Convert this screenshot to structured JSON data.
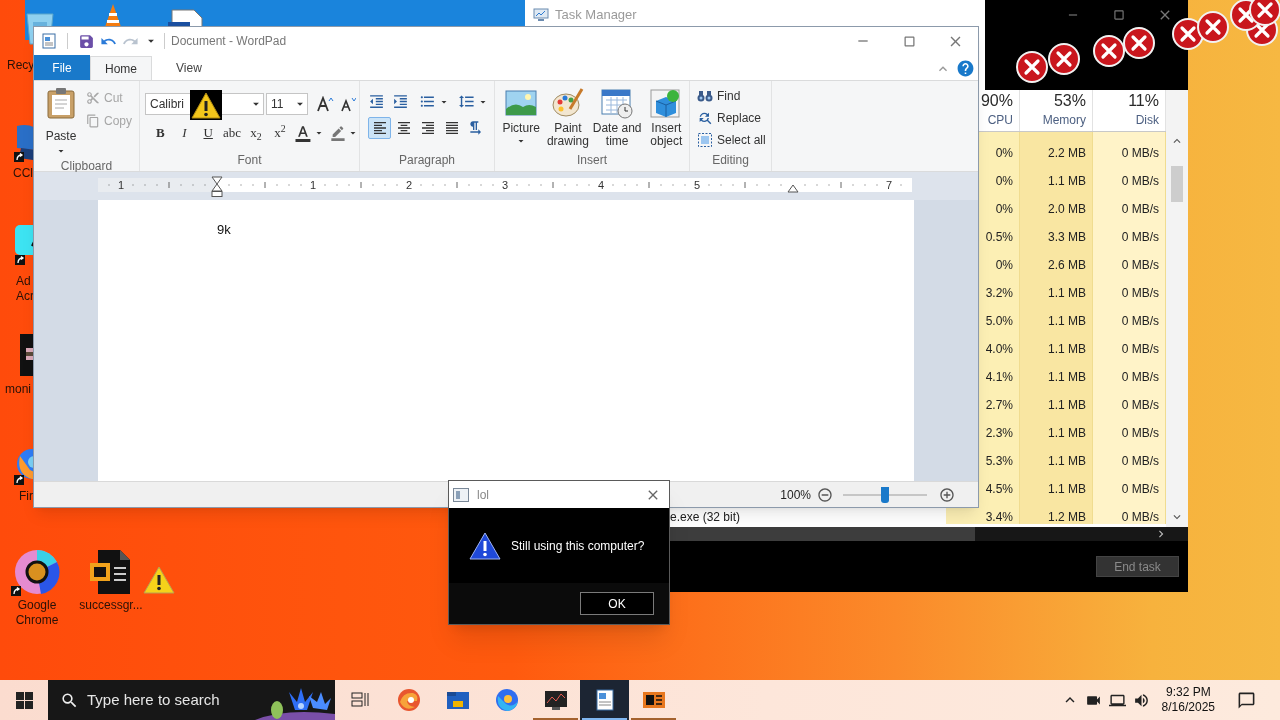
{
  "desktop_icons": [
    {
      "kind": "recycle-bin",
      "label": "Recy"
    },
    {
      "kind": "cone"
    },
    {
      "kind": "document"
    },
    {
      "kind": "ccleaner",
      "label": "CCl"
    },
    {
      "kind": "acrobat",
      "label": "Ad\nAcr"
    },
    {
      "kind": "monitor",
      "label": "moni"
    },
    {
      "kind": "firefox",
      "label": "Fir"
    },
    {
      "kind": "chrome",
      "label": "Google\nChrome"
    },
    {
      "kind": "word",
      "label": "successgr..."
    },
    {
      "kind": "warning"
    }
  ],
  "task_manager": {
    "title": "Task Manager",
    "columns": [
      {
        "value": "90%",
        "label": "CPU"
      },
      {
        "value": "53%",
        "label": "Memory"
      },
      {
        "value": "11%",
        "label": "Disk"
      }
    ],
    "rows": [
      {
        "cpu": "0%",
        "memory": "2.2 MB",
        "disk": "0 MB/s"
      },
      {
        "cpu": "0%",
        "memory": "1.1 MB",
        "disk": "0 MB/s"
      },
      {
        "cpu": "0%",
        "memory": "2.0 MB",
        "disk": "0 MB/s"
      },
      {
        "cpu": "0.5%",
        "memory": "3.3 MB",
        "disk": "0 MB/s"
      },
      {
        "cpu": "0%",
        "memory": "2.6 MB",
        "disk": "0 MB/s"
      },
      {
        "cpu": "3.2%",
        "memory": "1.1 MB",
        "disk": "0 MB/s"
      },
      {
        "cpu": "5.0%",
        "memory": "1.1 MB",
        "disk": "0 MB/s"
      },
      {
        "cpu": "4.0%",
        "memory": "1.1 MB",
        "disk": "0 MB/s"
      },
      {
        "cpu": "4.1%",
        "memory": "1.1 MB",
        "disk": "0 MB/s"
      },
      {
        "cpu": "2.7%",
        "memory": "1.1 MB",
        "disk": "0 MB/s"
      },
      {
        "cpu": "2.3%",
        "memory": "1.1 MB",
        "disk": "0 MB/s"
      },
      {
        "cpu": "5.3%",
        "memory": "1.1 MB",
        "disk": "0 MB/s"
      },
      {
        "cpu": "4.5%",
        "memory": "1.1 MB",
        "disk": "0 MB/s"
      },
      {
        "name": "e.exe (32 bit)",
        "cpu": "3.4%",
        "memory": "1.2 MB",
        "disk": "0 MB/s"
      }
    ],
    "button": {
      "label": "End task",
      "disabled": true
    }
  },
  "wordpad": {
    "title": "Document - WordPad",
    "quick_access": [
      {
        "kind": "save",
        "disabled": false
      },
      {
        "kind": "undo",
        "disabled": false
      },
      {
        "kind": "redo",
        "disabled": true
      }
    ],
    "tabs": [
      {
        "label": "File",
        "kind": "file",
        "selected": false
      },
      {
        "label": "Home",
        "kind": "tab",
        "selected": true
      },
      {
        "label": "View",
        "kind": "tab",
        "selected": false
      }
    ],
    "clipboard": {
      "label": "Clipboard",
      "paste": "Paste",
      "items": [
        {
          "kind": "cut",
          "label": "Cut",
          "disabled": true
        },
        {
          "kind": "copy",
          "label": "Copy",
          "disabled": true
        }
      ]
    },
    "font": {
      "label": "Font",
      "family": "Calibri",
      "size": "11",
      "styles": [
        {
          "kind": "bold",
          "text": "B"
        },
        {
          "kind": "italic",
          "text": "I"
        },
        {
          "kind": "underline",
          "text": "U"
        },
        {
          "kind": "strike",
          "text": "abc"
        },
        {
          "kind": "subscript",
          "text": "x$_{2}$"
        },
        {
          "kind": "superscript",
          "text": "x$^{2}$"
        }
      ]
    },
    "paragraph": {
      "label": "Paragraph",
      "alignment": [
        {
          "kind": "left",
          "selected": true
        },
        {
          "kind": "center",
          "selected": false
        },
        {
          "kind": "right",
          "selected": false
        },
        {
          "kind": "justify",
          "selected": false
        }
      ]
    },
    "insert": {
      "label": "Insert",
      "items": [
        {
          "kind": "picture",
          "label": "Picture"
        },
        {
          "kind": "paint",
          "label": "Paint drawing"
        },
        {
          "kind": "datetime",
          "label": "Date and time"
        },
        {
          "kind": "object",
          "label": "Insert object"
        }
      ]
    },
    "editing": {
      "label": "Editing",
      "items": [
        {
          "kind": "find",
          "label": "Find"
        },
        {
          "kind": "replace",
          "label": "Replace"
        },
        {
          "kind": "select-all",
          "label": "Select all"
        }
      ]
    },
    "ruler": [
      "1",
      "1",
      "2",
      "3",
      "4",
      "5",
      "7"
    ],
    "document_text": "9k",
    "zoom": {
      "text": "100%",
      "level": 0.5
    }
  },
  "dialog": {
    "title": "lol",
    "message": "Still using this computer?",
    "button": "OK"
  },
  "taskbar": {
    "search_placeholder": "Type here to search",
    "apps": [
      {
        "kind": "task-view",
        "running": false,
        "selected": false
      },
      {
        "kind": "edge",
        "running": false,
        "selected": false
      },
      {
        "kind": "explorer",
        "running": false,
        "selected": false
      },
      {
        "kind": "firefox",
        "running": false,
        "selected": false
      },
      {
        "kind": "monitor",
        "running": true,
        "selected": false
      },
      {
        "kind": "wordpad",
        "running": true,
        "selected": true
      },
      {
        "kind": "slides",
        "running": true,
        "selected": false
      }
    ],
    "time": "9:32 PM",
    "date": "8/16/2025"
  }
}
